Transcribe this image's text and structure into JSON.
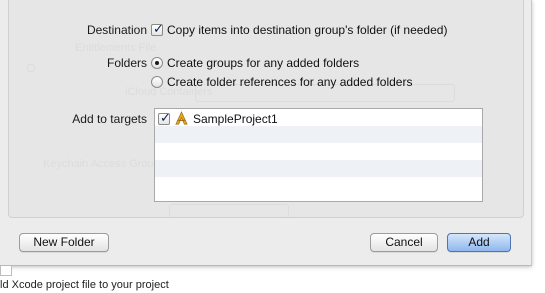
{
  "dialog": {
    "destination_label": "Destination",
    "copy_items_label": "Copy items into destination group's folder (if needed)",
    "copy_items_checked": true,
    "folders_label": "Folders",
    "folder_options": [
      {
        "label": "Create groups for any added folders",
        "selected": true
      },
      {
        "label": "Create folder references for any added folders",
        "selected": false
      }
    ],
    "targets_label": "Add to targets",
    "targets": [
      {
        "label": "SampleProject1",
        "checked": true,
        "icon": "app-target-icon"
      }
    ],
    "buttons": {
      "new_folder": "New Folder",
      "cancel": "Cancel",
      "add": "Add"
    }
  },
  "background": {
    "ghost_texts": [
      "Entitlements File",
      "iCloud Containers",
      "Keychain Access Groups"
    ]
  },
  "caption": "ld Xcode project file to your project",
  "colors": {
    "sheet_bg": "#ececec",
    "primary_button": "#8fb7ee",
    "list_stripe": "#eef2f7"
  }
}
